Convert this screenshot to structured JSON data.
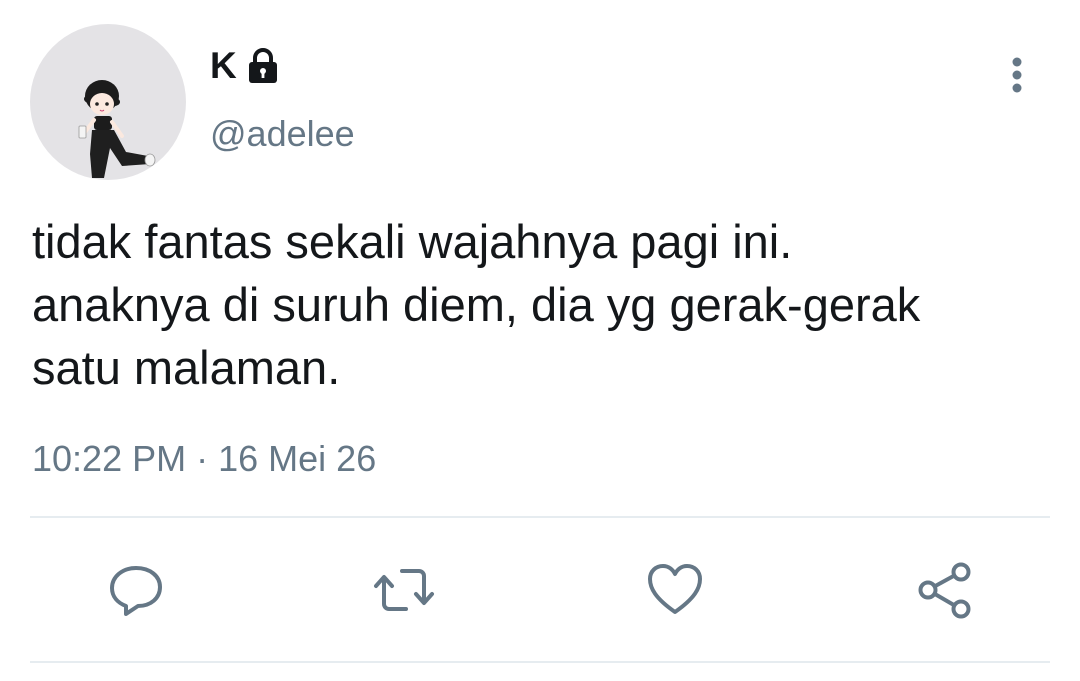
{
  "tweet": {
    "author": {
      "display_name": "K",
      "handle": "@adelee",
      "protected_icon": "lock-icon",
      "avatar": "avatar-illustration"
    },
    "text_lines": [
      "tidak fantas sekali wajahnya pagi ini.",
      "anaknya di suruh diem, dia yg gerak-gerak",
      "satu malaman."
    ],
    "time": "10:22 PM",
    "separator": "·",
    "date": "16 Mei 26",
    "menu_icon": "more-vertical-icon",
    "actions": [
      {
        "name": "reply",
        "icon": "reply-icon"
      },
      {
        "name": "retweet",
        "icon": "retweet-icon"
      },
      {
        "name": "like",
        "icon": "heart-icon"
      },
      {
        "name": "share",
        "icon": "share-icon"
      }
    ]
  },
  "colors": {
    "text": "#14171a",
    "secondary": "#657786",
    "icon": "#657786",
    "divider": "#e6ecf0"
  }
}
